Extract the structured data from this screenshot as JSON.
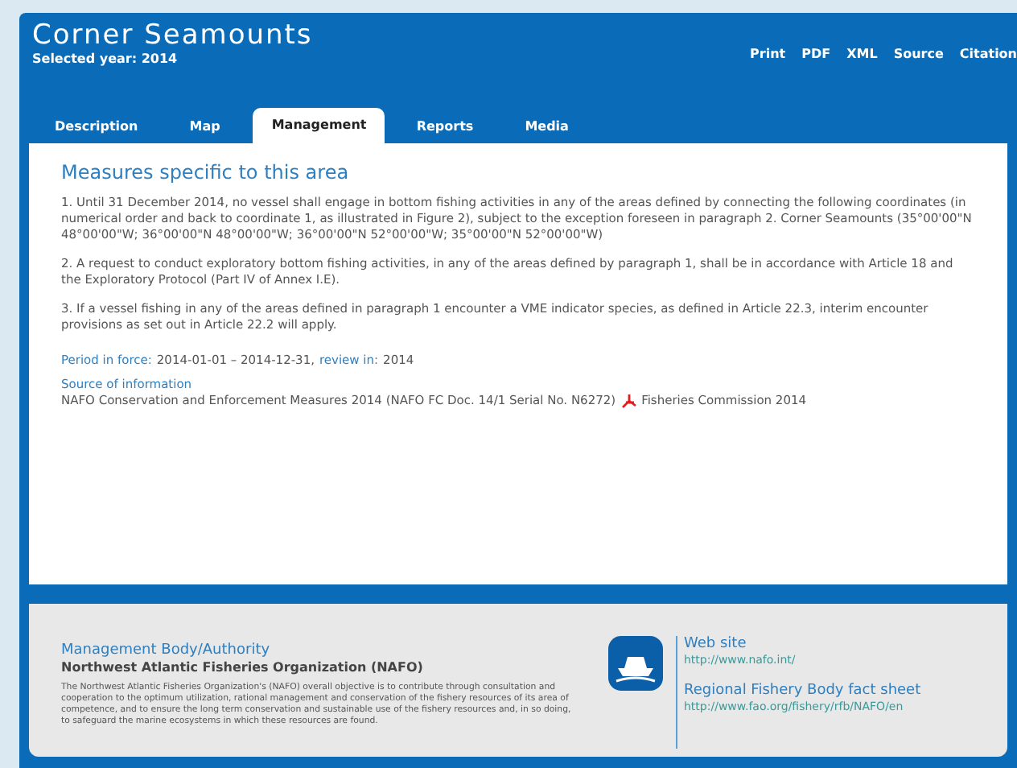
{
  "header": {
    "title": "Corner Seamounts",
    "subtitle": "Selected year: 2014",
    "links": [
      "Print",
      "PDF",
      "XML",
      "Source",
      "Citation"
    ]
  },
  "tabs": [
    {
      "label": "Description",
      "selected": false
    },
    {
      "label": "Map",
      "selected": false
    },
    {
      "label": "Management",
      "selected": true
    },
    {
      "label": "Reports",
      "selected": false
    },
    {
      "label": "Media",
      "selected": false
    }
  ],
  "content": {
    "heading": "Measures specific to this area",
    "paragraphs": [
      "1. Until 31 December 2014, no vessel shall engage in bottom fishing activities in any of the areas defined by connecting the following coordinates (in numerical order and back to coordinate 1, as illustrated in Figure 2), subject to the exception foreseen in paragraph 2. Corner Seamounts (35°00'00\"N 48°00'00\"W; 36°00'00\"N 48°00'00\"W; 36°00'00\"N 52°00'00\"W; 35°00'00\"N 52°00'00\"W)",
      "2. A request to conduct exploratory bottom fishing activities, in any of the areas defined by paragraph 1, shall be in accordance with Article 18 and the Exploratory Protocol (Part IV of Annex I.E).",
      "3. If a vessel fishing in any of the areas defined in paragraph 1 encounter a VME indicator species, as defined in Article 22.3, interim encounter provisions as set out in Article 22.2 will apply."
    ],
    "period_label": "Period in force:",
    "period_value": "2014-01-01 – 2014-12-31,",
    "review_label": "review in:",
    "review_value": "2014",
    "source_label": "Source of information",
    "source_text": "NAFO Conservation and Enforcement Measures 2014 (NAFO FC Doc. 14/1 Serial No. N6272)",
    "source_link": "Fisheries Commission 2014"
  },
  "footer": {
    "body_label": "Management Body/Authority",
    "body_name": "Northwest Atlantic Fisheries Organization (NAFO)",
    "description": "The Northwest Atlantic Fisheries Organization's (NAFO) overall objective is to contribute through consultation and cooperation to the optimum utilization, rational management and conservation of the fishery resources of its area of competence, and to ensure the long term conservation and sustainable use of the fishery resources and, in so doing, to safeguard the marine ecosystems in which these resources are found.",
    "links": [
      {
        "label": "Web site",
        "url": "http://www.nafo.int/"
      },
      {
        "label": "Regional Fishery Body fact sheet",
        "url": "http://www.fao.org/fishery/rfb/NAFO/en"
      }
    ]
  }
}
